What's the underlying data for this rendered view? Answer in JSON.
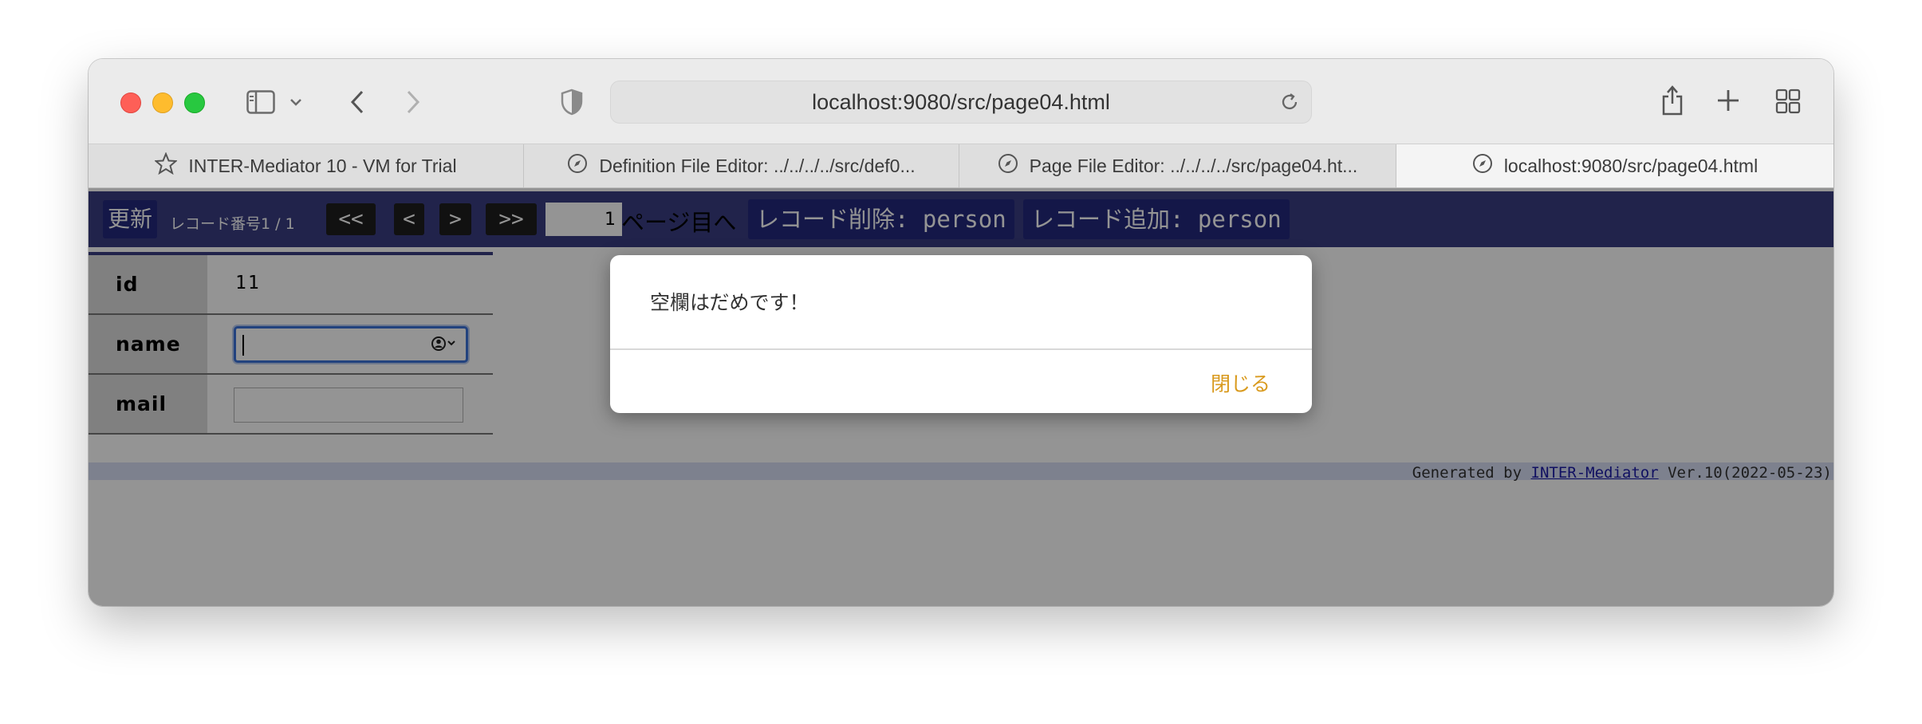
{
  "browser": {
    "url": "localhost:9080/src/page04.html",
    "tabs": [
      {
        "label": "INTER-Mediator 10 - VM for Trial",
        "icon": "star-icon",
        "active": false
      },
      {
        "label": "Definition File Editor: ../../../../src/def0...",
        "icon": "compass-icon",
        "active": false
      },
      {
        "label": "Page File Editor: ../../../../src/page04.ht...",
        "icon": "compass-icon",
        "active": false
      },
      {
        "label": "localhost:9080/src/page04.html",
        "icon": "compass-icon",
        "active": true
      }
    ]
  },
  "navbar": {
    "update_label": "更新",
    "record_info": "レコード番号1 / 1",
    "first_label": "<<",
    "prev_label": "<",
    "next_label": ">",
    "last_label": ">>",
    "page_value": "1",
    "page_suffix": "ページ目へ",
    "delete_label": "レコード削除: person",
    "add_label": "レコード追加: person"
  },
  "record": {
    "fields": [
      {
        "label": "id",
        "value": "11"
      },
      {
        "label": "name",
        "value": ""
      },
      {
        "label": "mail",
        "value": ""
      }
    ]
  },
  "footer": {
    "prefix": "Generated by ",
    "link": "INTER-Mediator",
    "suffix": " Ver.10(2022-05-23)"
  },
  "dialog": {
    "message": "空欄はだめです！",
    "close_label": "閉じる"
  },
  "colors": {
    "navbar": "#393d82",
    "accent_button": "#23287d",
    "dialog_close": "#d99a1e",
    "focus_ring": "#3b72d9"
  }
}
